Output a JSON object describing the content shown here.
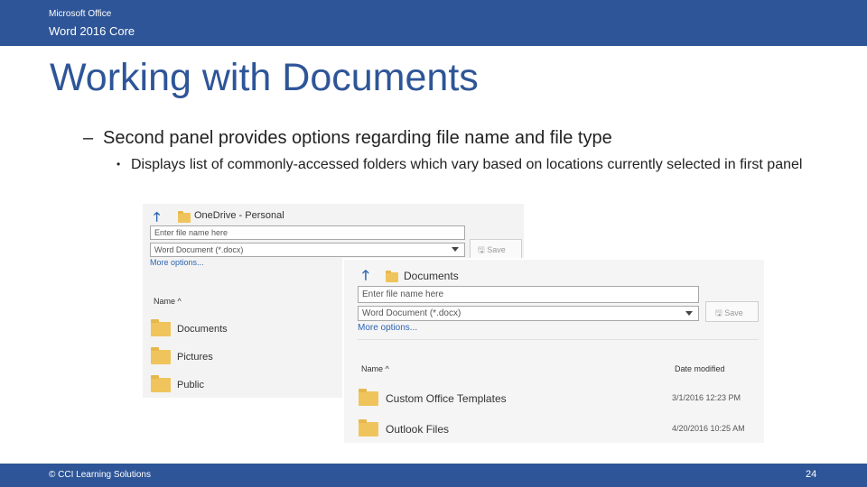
{
  "header": {
    "brand": "Microsoft Office",
    "course": "Word 2016 Core"
  },
  "slide": {
    "title": "Working with Documents",
    "bullet_dash": "–",
    "bullet_main": "Second panel provides options regarding file name and file type",
    "bullet_dot": "•",
    "bullet_sub": "Displays list of commonly-accessed folders which vary based on locations currently selected in first panel"
  },
  "panel_back": {
    "location": "OneDrive - Personal",
    "filename_placeholder": "Enter file name here",
    "filetype": "Word Document (*.docx)",
    "save_label": "Save",
    "more_options": "More options...",
    "name_header": "Name ^",
    "folders": [
      "Documents",
      "Pictures",
      "Public"
    ]
  },
  "panel_front": {
    "location": "Documents",
    "filename_placeholder": "Enter file name here",
    "filetype": "Word Document (*.docx)",
    "save_label": "Save",
    "more_options": "More options...",
    "name_header": "Name ^",
    "date_header": "Date modified",
    "rows": [
      {
        "name": "Custom Office Templates",
        "date": "3/1/2016 12:23 PM"
      },
      {
        "name": "Outlook Files",
        "date": "4/20/2016 10:25 AM"
      }
    ]
  },
  "footer": {
    "copyright": "© CCI Learning Solutions",
    "page_number": "24"
  }
}
